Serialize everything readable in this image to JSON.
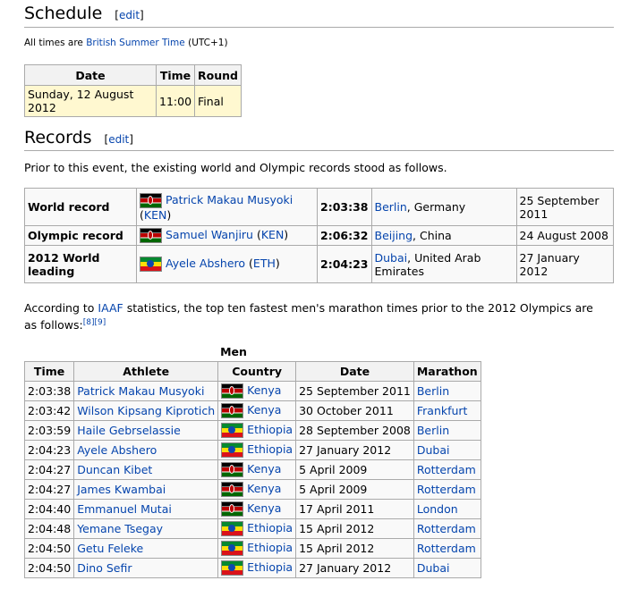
{
  "schedule": {
    "heading": "Schedule",
    "edit": "edit",
    "note_prefix": "All times are",
    "note_link": "British Summer Time",
    "note_suffix": "(UTC+1)",
    "headers": [
      "Date",
      "Time",
      "Round"
    ],
    "row": [
      "Sunday, 12 August 2012",
      "11:00",
      "Final"
    ]
  },
  "records": {
    "heading": "Records",
    "edit": "edit",
    "intro": "Prior to this event, the existing world and Olympic records stood as follows.",
    "rows": [
      {
        "label": "World record",
        "athlete": "Patrick Makau Musyoki",
        "country": "KEN",
        "flag": "ken",
        "time": "2:03:38",
        "place_link": "Berlin",
        "place_rest": ", Germany",
        "date": "25 September 2011"
      },
      {
        "label": "Olympic record",
        "athlete": "Samuel Wanjiru",
        "country": "KEN",
        "flag": "ken",
        "time": "2:06:32",
        "place_link": "Beijing",
        "place_rest": ", China",
        "date": "24 August 2008"
      },
      {
        "label": "2012 World leading",
        "athlete": "Ayele Abshero",
        "country": "ETH",
        "flag": "eth",
        "time": "2:04:23",
        "place_link": "Dubai",
        "place_rest": ", United Arab Emirates",
        "date": "27 January 2012"
      }
    ]
  },
  "stats": {
    "prefix": "According to",
    "link": "IAAF",
    "suffix": "statistics, the top ten fastest men's marathon times prior to the 2012 Olympics are as follows:",
    "refs": [
      "[8]",
      "[9]"
    ]
  },
  "men": {
    "caption": "Men",
    "headers": [
      "Time",
      "Athlete",
      "Country",
      "Date",
      "Marathon"
    ],
    "rows": [
      {
        "time": "2:03:38",
        "athlete": "Patrick Makau Musyoki",
        "flag": "ken",
        "country": "Kenya",
        "date": "25 September 2011",
        "marathon": "Berlin"
      },
      {
        "time": "2:03:42",
        "athlete": "Wilson Kipsang Kiprotich",
        "flag": "ken",
        "country": "Kenya",
        "date": "30 October 2011",
        "marathon": "Frankfurt"
      },
      {
        "time": "2:03:59",
        "athlete": "Haile Gebrselassie",
        "flag": "eth",
        "country": "Ethiopia",
        "date": "28 September 2008",
        "marathon": "Berlin"
      },
      {
        "time": "2:04:23",
        "athlete": "Ayele Abshero",
        "flag": "eth",
        "country": "Ethiopia",
        "date": "27 January 2012",
        "marathon": "Dubai"
      },
      {
        "time": "2:04:27",
        "athlete": "Duncan Kibet",
        "flag": "ken",
        "country": "Kenya",
        "date": "5 April 2009",
        "marathon": "Rotterdam"
      },
      {
        "time": "2:04:27",
        "athlete": "James Kwambai",
        "flag": "ken",
        "country": "Kenya",
        "date": "5 April 2009",
        "marathon": "Rotterdam"
      },
      {
        "time": "2:04:40",
        "athlete": "Emmanuel Mutai",
        "flag": "ken",
        "country": "Kenya",
        "date": "17 April 2011",
        "marathon": "London"
      },
      {
        "time": "2:04:48",
        "athlete": "Yemane Tsegay",
        "flag": "eth",
        "country": "Ethiopia",
        "date": "15 April 2012",
        "marathon": "Rotterdam"
      },
      {
        "time": "2:04:50",
        "athlete": "Getu Feleke",
        "flag": "eth",
        "country": "Ethiopia",
        "date": "15 April 2012",
        "marathon": "Rotterdam"
      },
      {
        "time": "2:04:50",
        "athlete": "Dino Sefir",
        "flag": "eth",
        "country": "Ethiopia",
        "date": "27 January 2012",
        "marathon": "Dubai"
      }
    ]
  }
}
